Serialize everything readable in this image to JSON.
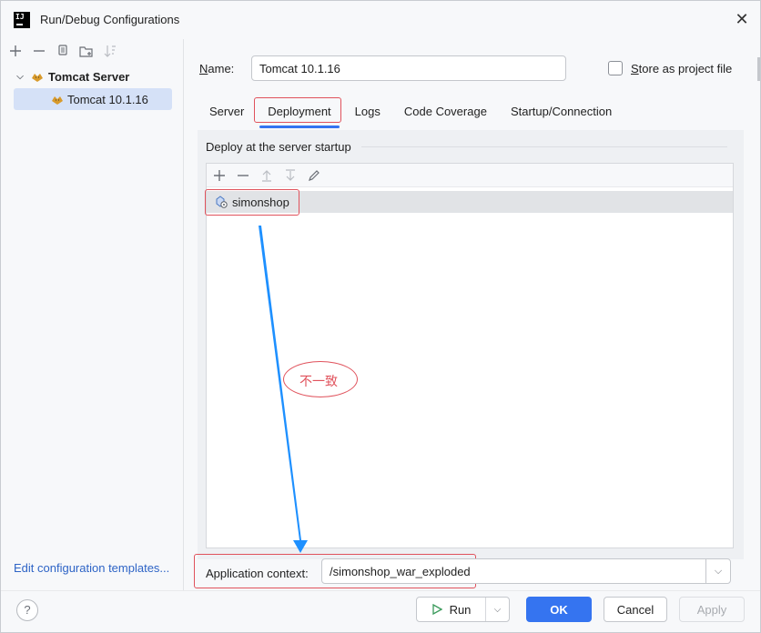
{
  "window": {
    "title": "Run/Debug Configurations",
    "app_icon_text": "IJ"
  },
  "left_panel": {
    "toolbar_icons": [
      "add-icon",
      "remove-icon",
      "copy-icon",
      "new-folder-icon",
      "sort-icon"
    ],
    "tree": {
      "parent_label": "Tomcat Server",
      "child_label": "Tomcat 10.1.16"
    },
    "edit_templates_link": "Edit configuration templates..."
  },
  "config": {
    "name_label_prefix": "",
    "name_label_mnemonic": "N",
    "name_label_rest": "ame:",
    "name_value": "Tomcat 10.1.16",
    "store_label_mnemonic": "S",
    "store_label_rest": "tore as project file",
    "store_checked": false
  },
  "tabs": [
    {
      "label": "Server",
      "active": false
    },
    {
      "label": "Deployment",
      "active": true
    },
    {
      "label": "Logs",
      "active": false
    },
    {
      "label": "Code Coverage",
      "active": false
    },
    {
      "label": "Startup/Connection",
      "active": false
    }
  ],
  "deployment": {
    "section_title": "Deploy at the server startup",
    "list_toolbar_icons": [
      "add-icon",
      "remove-icon",
      "move-up-icon",
      "move-down-icon",
      "edit-icon"
    ],
    "artifacts": [
      "simonshop"
    ],
    "context_label": "Application context:",
    "context_value": "/simonshop_war_exploded"
  },
  "annotation": {
    "text": "不一致",
    "color": "#e0525c",
    "arrow_color": "#1e90ff"
  },
  "footer": {
    "help": "?",
    "run_label": "Run",
    "ok_label": "OK",
    "cancel_label": "Cancel",
    "apply_label": "Apply"
  },
  "colors": {
    "accent": "#3574f0",
    "selection": "#d5e1f7",
    "link": "#2e64c6",
    "highlight_border": "#e0525c"
  }
}
